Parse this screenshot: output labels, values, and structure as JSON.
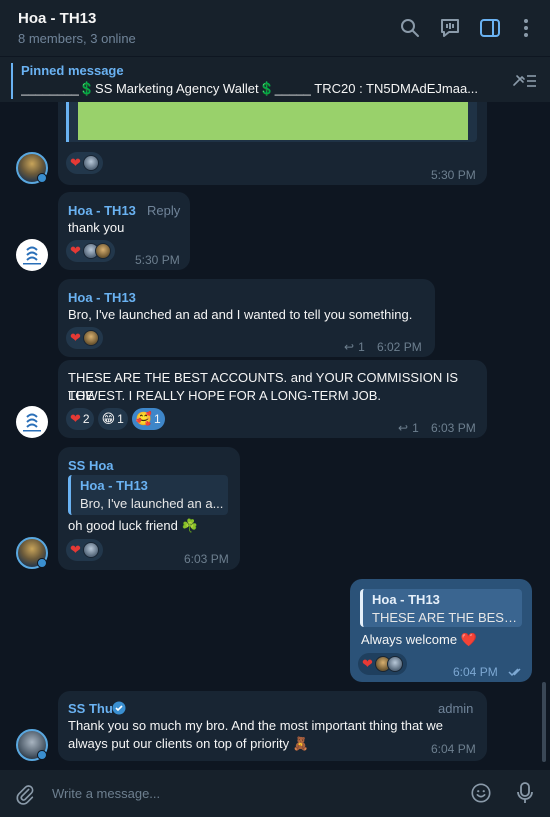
{
  "header": {
    "title": "Hoa - TH13",
    "subtitle": "8 members, 3 online"
  },
  "pinned": {
    "label": "Pinned message",
    "text": "________💲SS Marketing Agency Wallet💲_____  TRC20 : TN5DMAdEJmaa..."
  },
  "messages": [
    {
      "time": "5:30 PM"
    },
    {
      "sender": "Hoa - TH13",
      "reply_label": "Reply",
      "text": "thank you",
      "time": "5:30 PM"
    },
    {
      "sender": "Hoa - TH13",
      "text": "Bro, I've launched an ad and I wanted to tell you something.",
      "replies": "1",
      "time": "6:02 PM"
    },
    {
      "text_line1": "THESE ARE THE BEST ACCOUNTS. and YOUR COMMISSION IS THE",
      "text_line2": "LOWEST. I REALLY HOPE FOR A LONG-TERM JOB.",
      "reactions": [
        "2",
        "1",
        "1"
      ],
      "replies": "1",
      "time": "6:03 PM"
    },
    {
      "sender": "SS Hoa",
      "quote_name": "Hoa - TH13",
      "quote_text": "Bro, I've launched an a...",
      "text": "oh good luck friend ☘️",
      "time": "6:03 PM"
    },
    {
      "quote_name": "Hoa - TH13",
      "quote_text": "THESE ARE THE BEST A...",
      "text": "Always welcome ❤️",
      "time": "6:04 PM"
    },
    {
      "sender": "SS Thu",
      "admin_label": "admin",
      "text_line1": "Thank you so much my bro. And the most important thing that we",
      "text_line2": "always put our clients on top of priority 🧸",
      "time": "6:04 PM"
    }
  ],
  "composer": {
    "placeholder": "Write a message..."
  },
  "colors": {
    "accent": "#6ab2f2",
    "background": "#0e1621",
    "bubble_in": "#182533",
    "bubble_out": "#2b5278"
  }
}
